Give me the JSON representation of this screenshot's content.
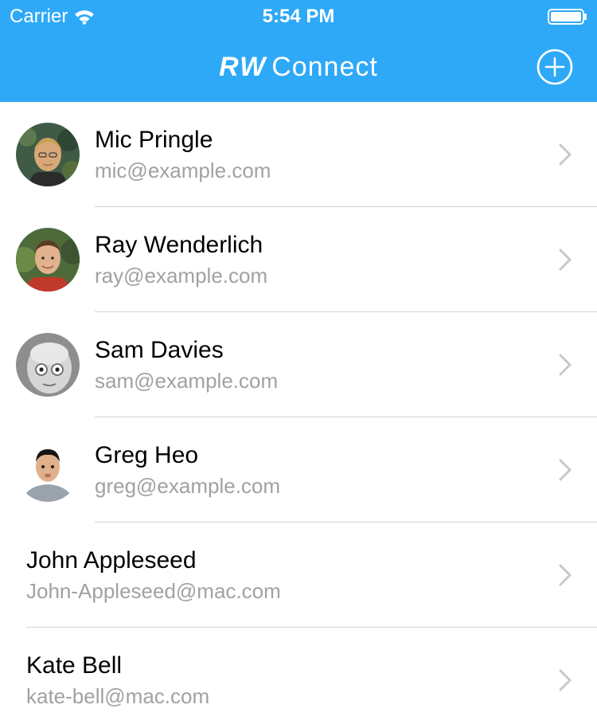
{
  "status_bar": {
    "carrier": "Carrier",
    "time": "5:54 PM"
  },
  "nav_bar": {
    "title_brand": "RW",
    "title_rest": "Connect",
    "add_icon": "plus-circle-icon",
    "background_color": "#2EA9F7"
  },
  "contacts": [
    {
      "name": "Mic Pringle",
      "email": "mic@example.com",
      "has_avatar": true
    },
    {
      "name": "Ray Wenderlich",
      "email": "ray@example.com",
      "has_avatar": true
    },
    {
      "name": "Sam Davies",
      "email": "sam@example.com",
      "has_avatar": true
    },
    {
      "name": "Greg Heo",
      "email": "greg@example.com",
      "has_avatar": true
    },
    {
      "name": "John Appleseed",
      "email": "John-Appleseed@mac.com",
      "has_avatar": false
    },
    {
      "name": "Kate Bell",
      "email": "kate-bell@mac.com",
      "has_avatar": false
    }
  ],
  "colors": {
    "primary_text": "#000000",
    "secondary_text": "#A1A1A6",
    "separator": "#D4D4D6",
    "chevron": "#C7C7CC"
  }
}
